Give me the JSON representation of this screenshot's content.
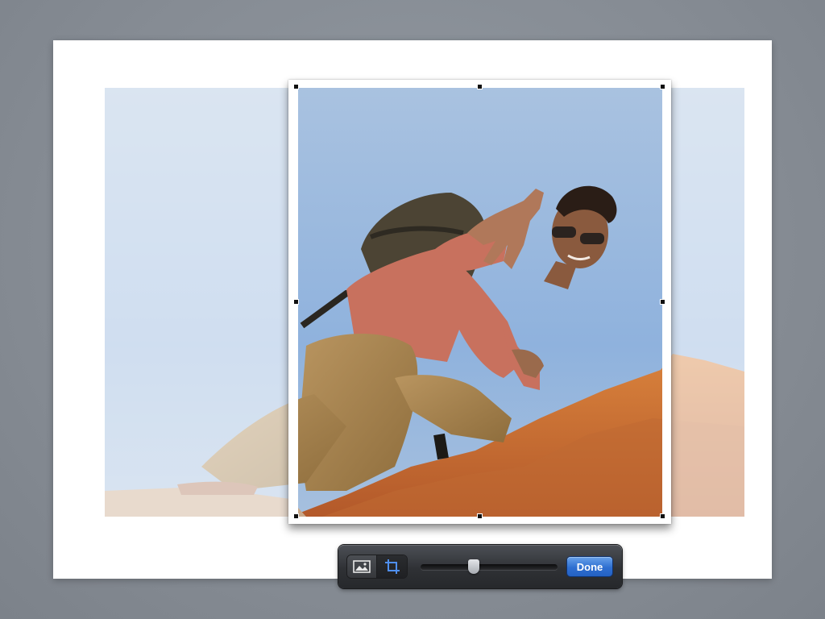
{
  "toolbar": {
    "mode_buttons": [
      {
        "name": "image",
        "icon": "image-icon",
        "selected": false
      },
      {
        "name": "crop",
        "icon": "crop-icon",
        "selected": true
      }
    ],
    "zoom_slider": {
      "value": 0.39
    },
    "done_label": "Done"
  },
  "colors": {
    "background": "#868c94",
    "accent": "#2f6fd1",
    "crop_icon": "#4f8ff0"
  }
}
